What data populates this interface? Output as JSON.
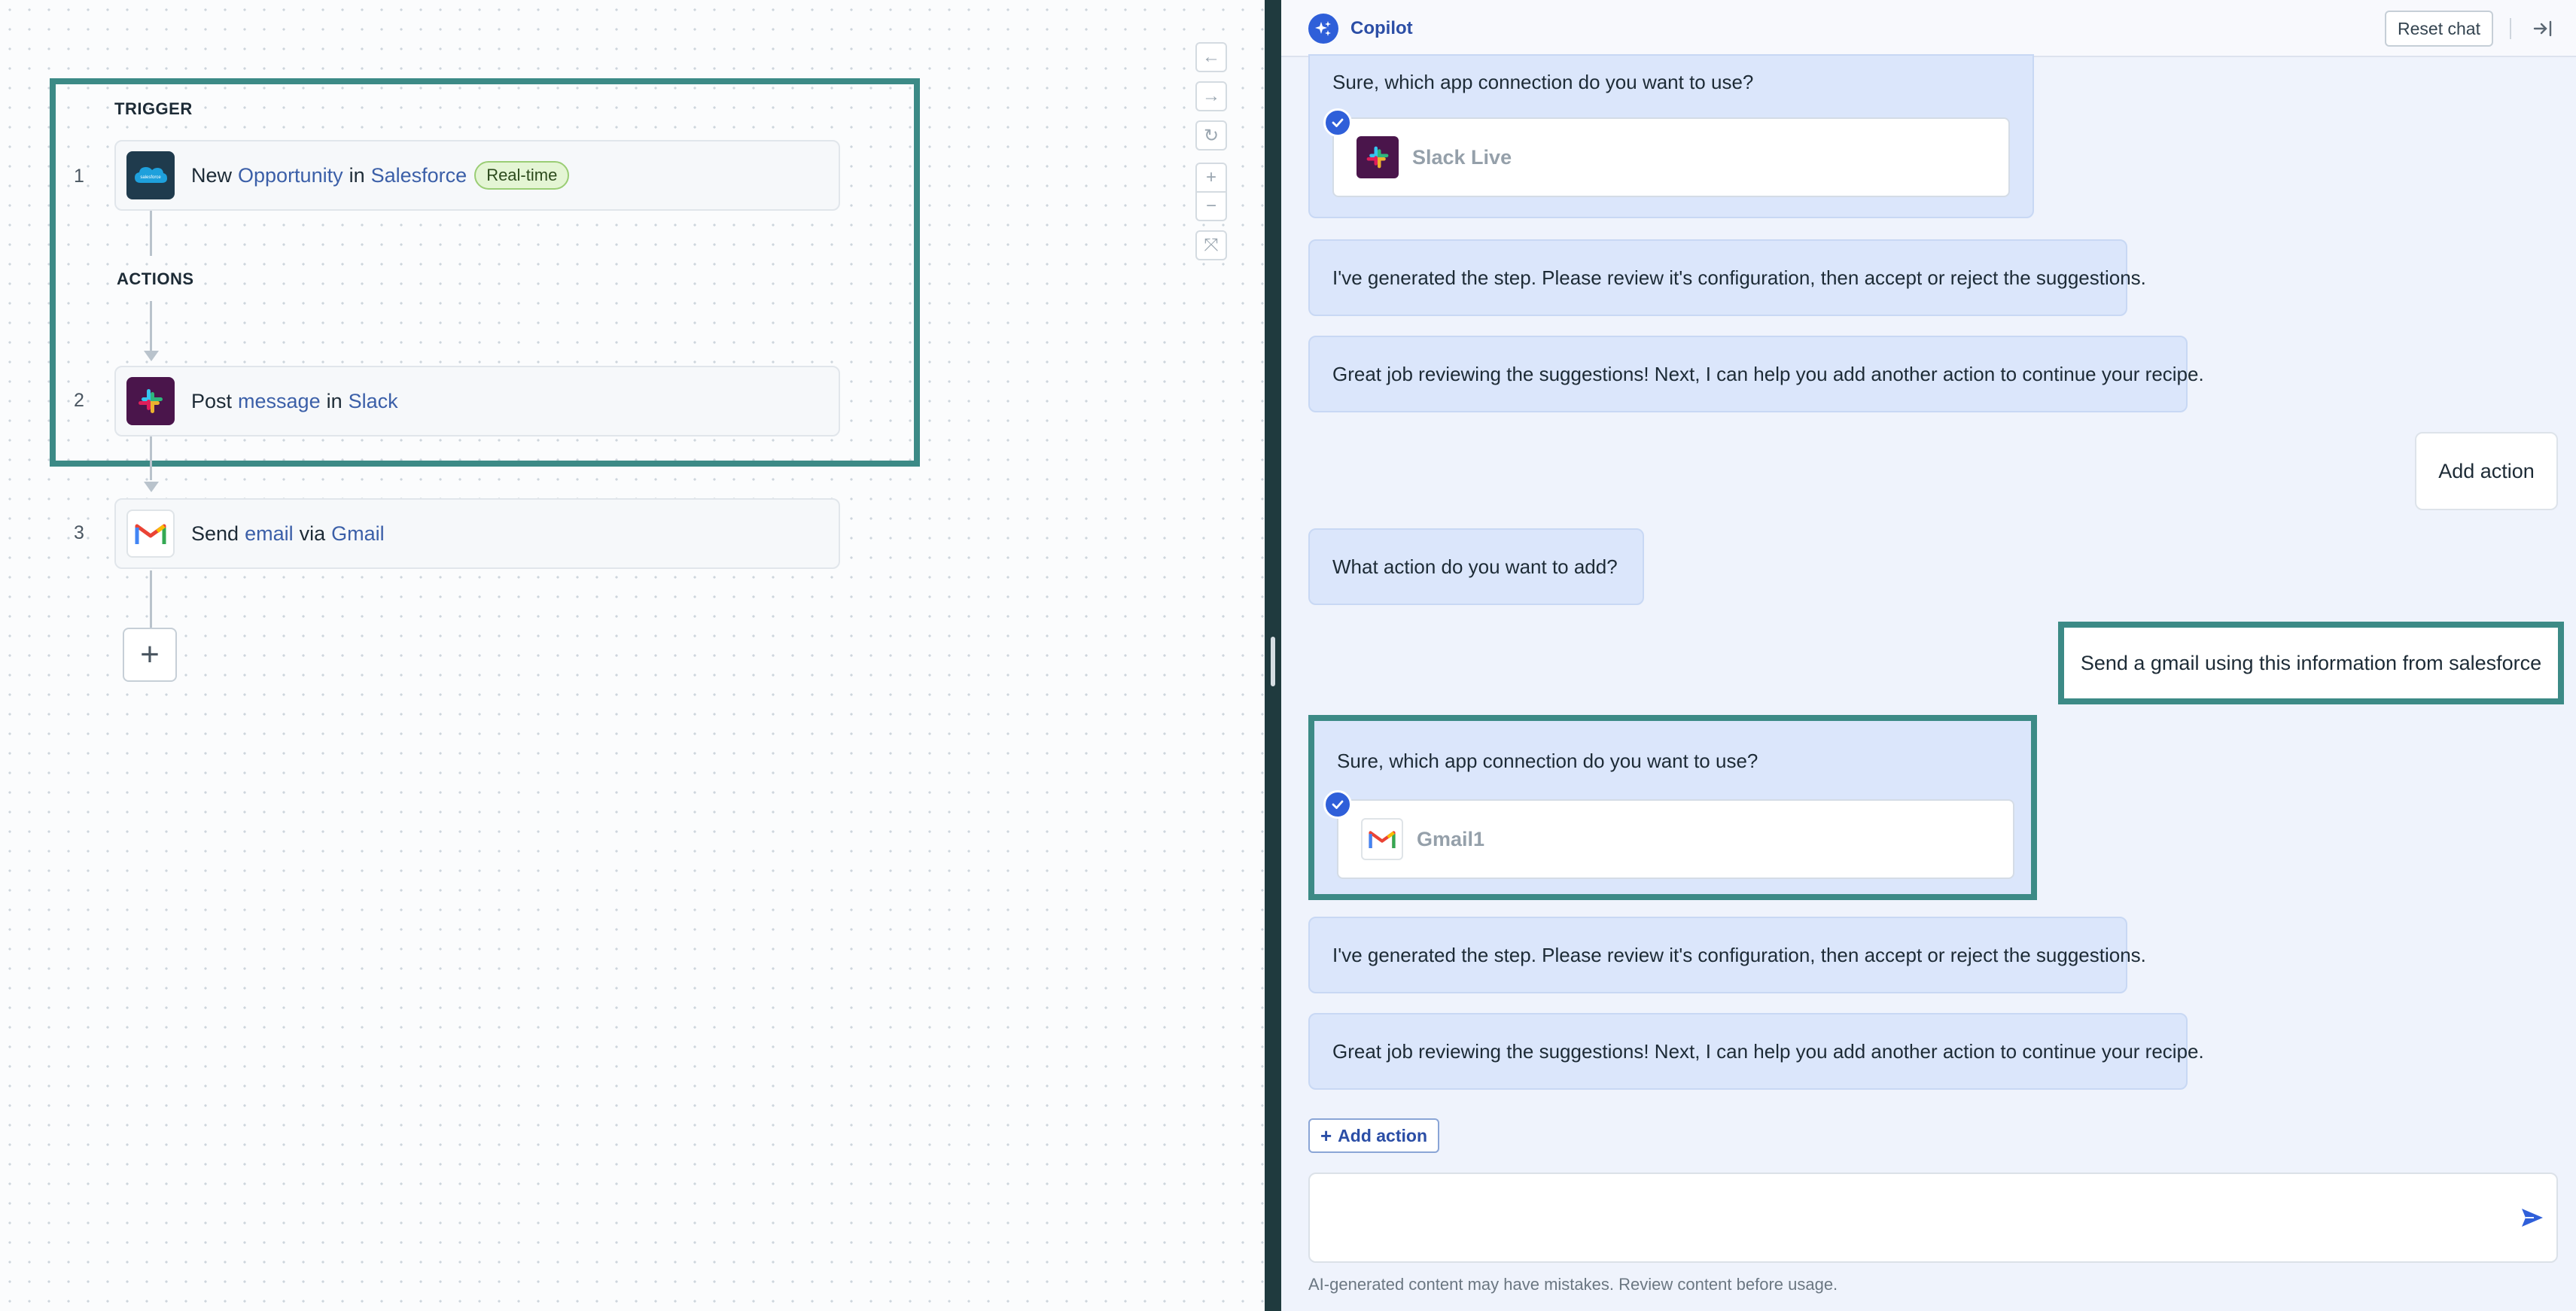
{
  "canvas": {
    "trigger_label": "TRIGGER",
    "actions_label": "ACTIONS",
    "steps": [
      {
        "num": "1",
        "verb": "New",
        "object": "Opportunity",
        "prep": "in",
        "app": "Salesforce",
        "badge": "Real-time",
        "icon": "salesforce-icon"
      },
      {
        "num": "2",
        "verb": "Post",
        "object": "message",
        "prep": "in",
        "app": "Slack",
        "icon": "slack-icon"
      },
      {
        "num": "3",
        "verb": "Send",
        "object": "email",
        "prep": "via",
        "app": "Gmail",
        "icon": "gmail-icon"
      }
    ],
    "add_step_glyph": "+",
    "zoom_controls": [
      "←",
      "→",
      "↻",
      "+",
      "−",
      "⤧"
    ]
  },
  "copilot": {
    "title": "Copilot",
    "reset_label": "Reset chat",
    "messages": [
      {
        "role": "bot",
        "text": "Sure, which app connection do you want to use?",
        "connection": "Slack Live"
      },
      {
        "role": "bot",
        "text": "I've generated the step. Please review it's configuration, then accept or reject the suggestions."
      },
      {
        "role": "bot",
        "text": "Great job reviewing the suggestions! Next, I can help you add another action to continue your recipe."
      },
      {
        "role": "user",
        "text": "Add action"
      },
      {
        "role": "bot",
        "text": "What action do you want to add?"
      },
      {
        "role": "user",
        "text": "Send a gmail using this information from salesforce"
      },
      {
        "role": "bot",
        "text": "Sure, which app connection do you want to use?",
        "connection": "Gmail1"
      },
      {
        "role": "bot",
        "text": "I've generated the step. Please review it's configuration, then accept or reject the suggestions."
      },
      {
        "role": "bot",
        "text": "Great job reviewing the suggestions! Next, I can help you add another action to continue your recipe."
      }
    ],
    "add_action_label": "Add action",
    "input_placeholder": "",
    "disclaimer": "AI-generated content may have mistakes. Review content before usage."
  },
  "colors": {
    "accent": "#2f5fd9",
    "highlight": "#3c8a86",
    "bot_bubble": "#dbe6fb",
    "realtime_badge": "#e4f5d4"
  }
}
